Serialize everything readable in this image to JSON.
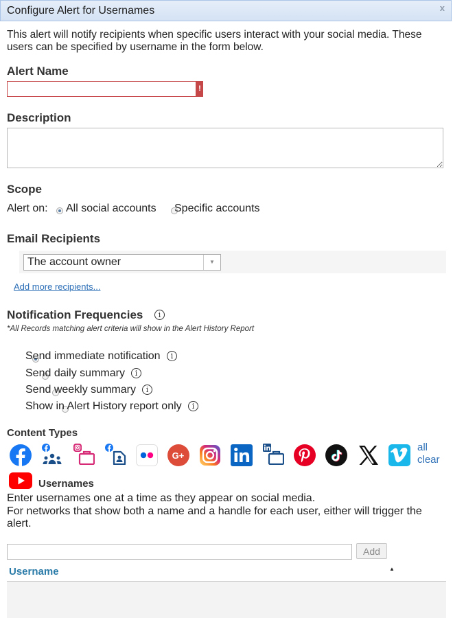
{
  "dialog": {
    "title": "Configure Alert for Usernames",
    "close_label": "x"
  },
  "intro": "This alert will notify recipients when specific users interact with your social media. These users can be specified by username in the form below.",
  "alert_name": {
    "heading": "Alert Name",
    "value": "",
    "error_mark": "!"
  },
  "description": {
    "heading": "Description",
    "value": ""
  },
  "scope": {
    "heading": "Scope",
    "label": "Alert on:",
    "options": [
      "All social accounts",
      "Specific accounts"
    ],
    "selected": "All social accounts"
  },
  "email": {
    "heading": "Email Recipients",
    "selected": "The account owner",
    "add_more": "Add more recipients..."
  },
  "frequencies": {
    "heading": "Notification Frequencies",
    "note": "*All Records matching alert criteria will show in the Alert History Report",
    "options": [
      "Send immediate notification",
      "Send daily summary",
      "Send weekly summary",
      "Show in Alert History report only"
    ],
    "selected": "Send immediate notification"
  },
  "content_types": {
    "heading": "Content Types",
    "icons": [
      "facebook-icon",
      "facebook-groups-icon",
      "instagram-business-icon",
      "facebook-page-icon",
      "flickr-icon",
      "google-plus-icon",
      "instagram-icon",
      "linkedin-icon",
      "linkedin-page-icon",
      "pinterest-icon",
      "tiktok-icon",
      "x-icon",
      "vimeo-icon",
      "youtube-icon"
    ],
    "all_label": "all",
    "clear_label": "clear"
  },
  "usernames": {
    "heading": "Usernames",
    "help_line1": "Enter usernames one at a time as they appear on social media.",
    "help_line2": "For networks that show both a name and a handle for each user, either will trigger the alert.",
    "input_value": "",
    "add_label": "Add",
    "column_header": "Username"
  },
  "colors": {
    "accent": "#2c6fb7",
    "error": "#c64747",
    "header_link": "#2a7ba8"
  }
}
